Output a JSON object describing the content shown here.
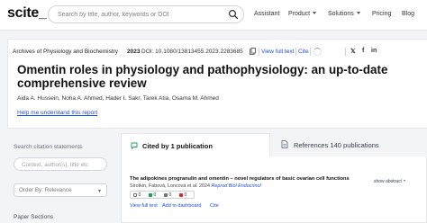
{
  "app": {
    "logo": "scite_"
  },
  "search": {
    "placeholder": "Search by title, author, keywords or DOI"
  },
  "nav": {
    "assistant": "Assistant",
    "product": "Product",
    "solutions": "Solutions",
    "pricing": "Pricing",
    "blog": "Blog"
  },
  "article": {
    "journal": "Archives of Physiology and Biochemistry",
    "year": "2023",
    "doi": "DOI: 10.1080/13813455.2023.2283685",
    "view_full_text": "View full text",
    "cite": "Cite",
    "title": "Omentin roles in physiology and pathophysiology: an up-to-date comprehensive review",
    "authors": "Aida A. Hussein, Noha A. Ahmed, Hader I. Sakr, Tarek Atia, Osama M. Ahmed",
    "help_link": "Help me understand this report"
  },
  "social": {
    "twitter": "𝕏",
    "facebook": "f",
    "linkedin": "in"
  },
  "filters": {
    "search_label": "Search citation statements",
    "search_placeholder": "Context, author(s), title etc",
    "order_by": "Order By: Relevance",
    "bottom_text": "Paper Sections"
  },
  "tabs": {
    "cited_by": "Cited by 1 publication",
    "references": "References 140 publications"
  },
  "result": {
    "title": "The adipokines progranulin and omentin – novel regulators of basic ovarian cell functions",
    "authors_year": "Sirotkin, Fabová, Loncová et al. 2024",
    "journal": "Reprod Biol Endocrinol",
    "show_abstract": "show abstract",
    "stats": [
      "0",
      "0",
      "0",
      "0"
    ],
    "actions": {
      "view_full_text": "View full text",
      "add_to_dashboard": "Add to dashboard",
      "cite": "Cite"
    }
  },
  "colors": {
    "accent": "#1d4ed8",
    "supporting": "#16a34a",
    "mentioning": "#6b7280",
    "contrasting": "#dc2626"
  }
}
